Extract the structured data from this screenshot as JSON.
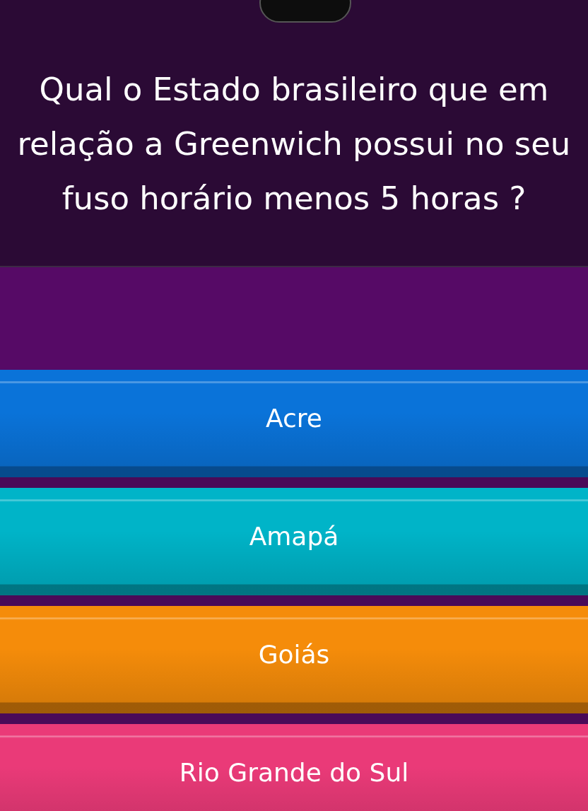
{
  "question": "Qual o Estado brasileiro que em relação a Greenwich possui no seu fuso horário menos 5 horas ?",
  "answers": [
    {
      "label": "Acre",
      "color": "#0a73d9"
    },
    {
      "label": "Amapá",
      "color": "#00b4c8"
    },
    {
      "label": "Goiás",
      "color": "#f58c0a"
    },
    {
      "label": "Rio Grande do Sul",
      "color": "#ea3a78"
    }
  ]
}
